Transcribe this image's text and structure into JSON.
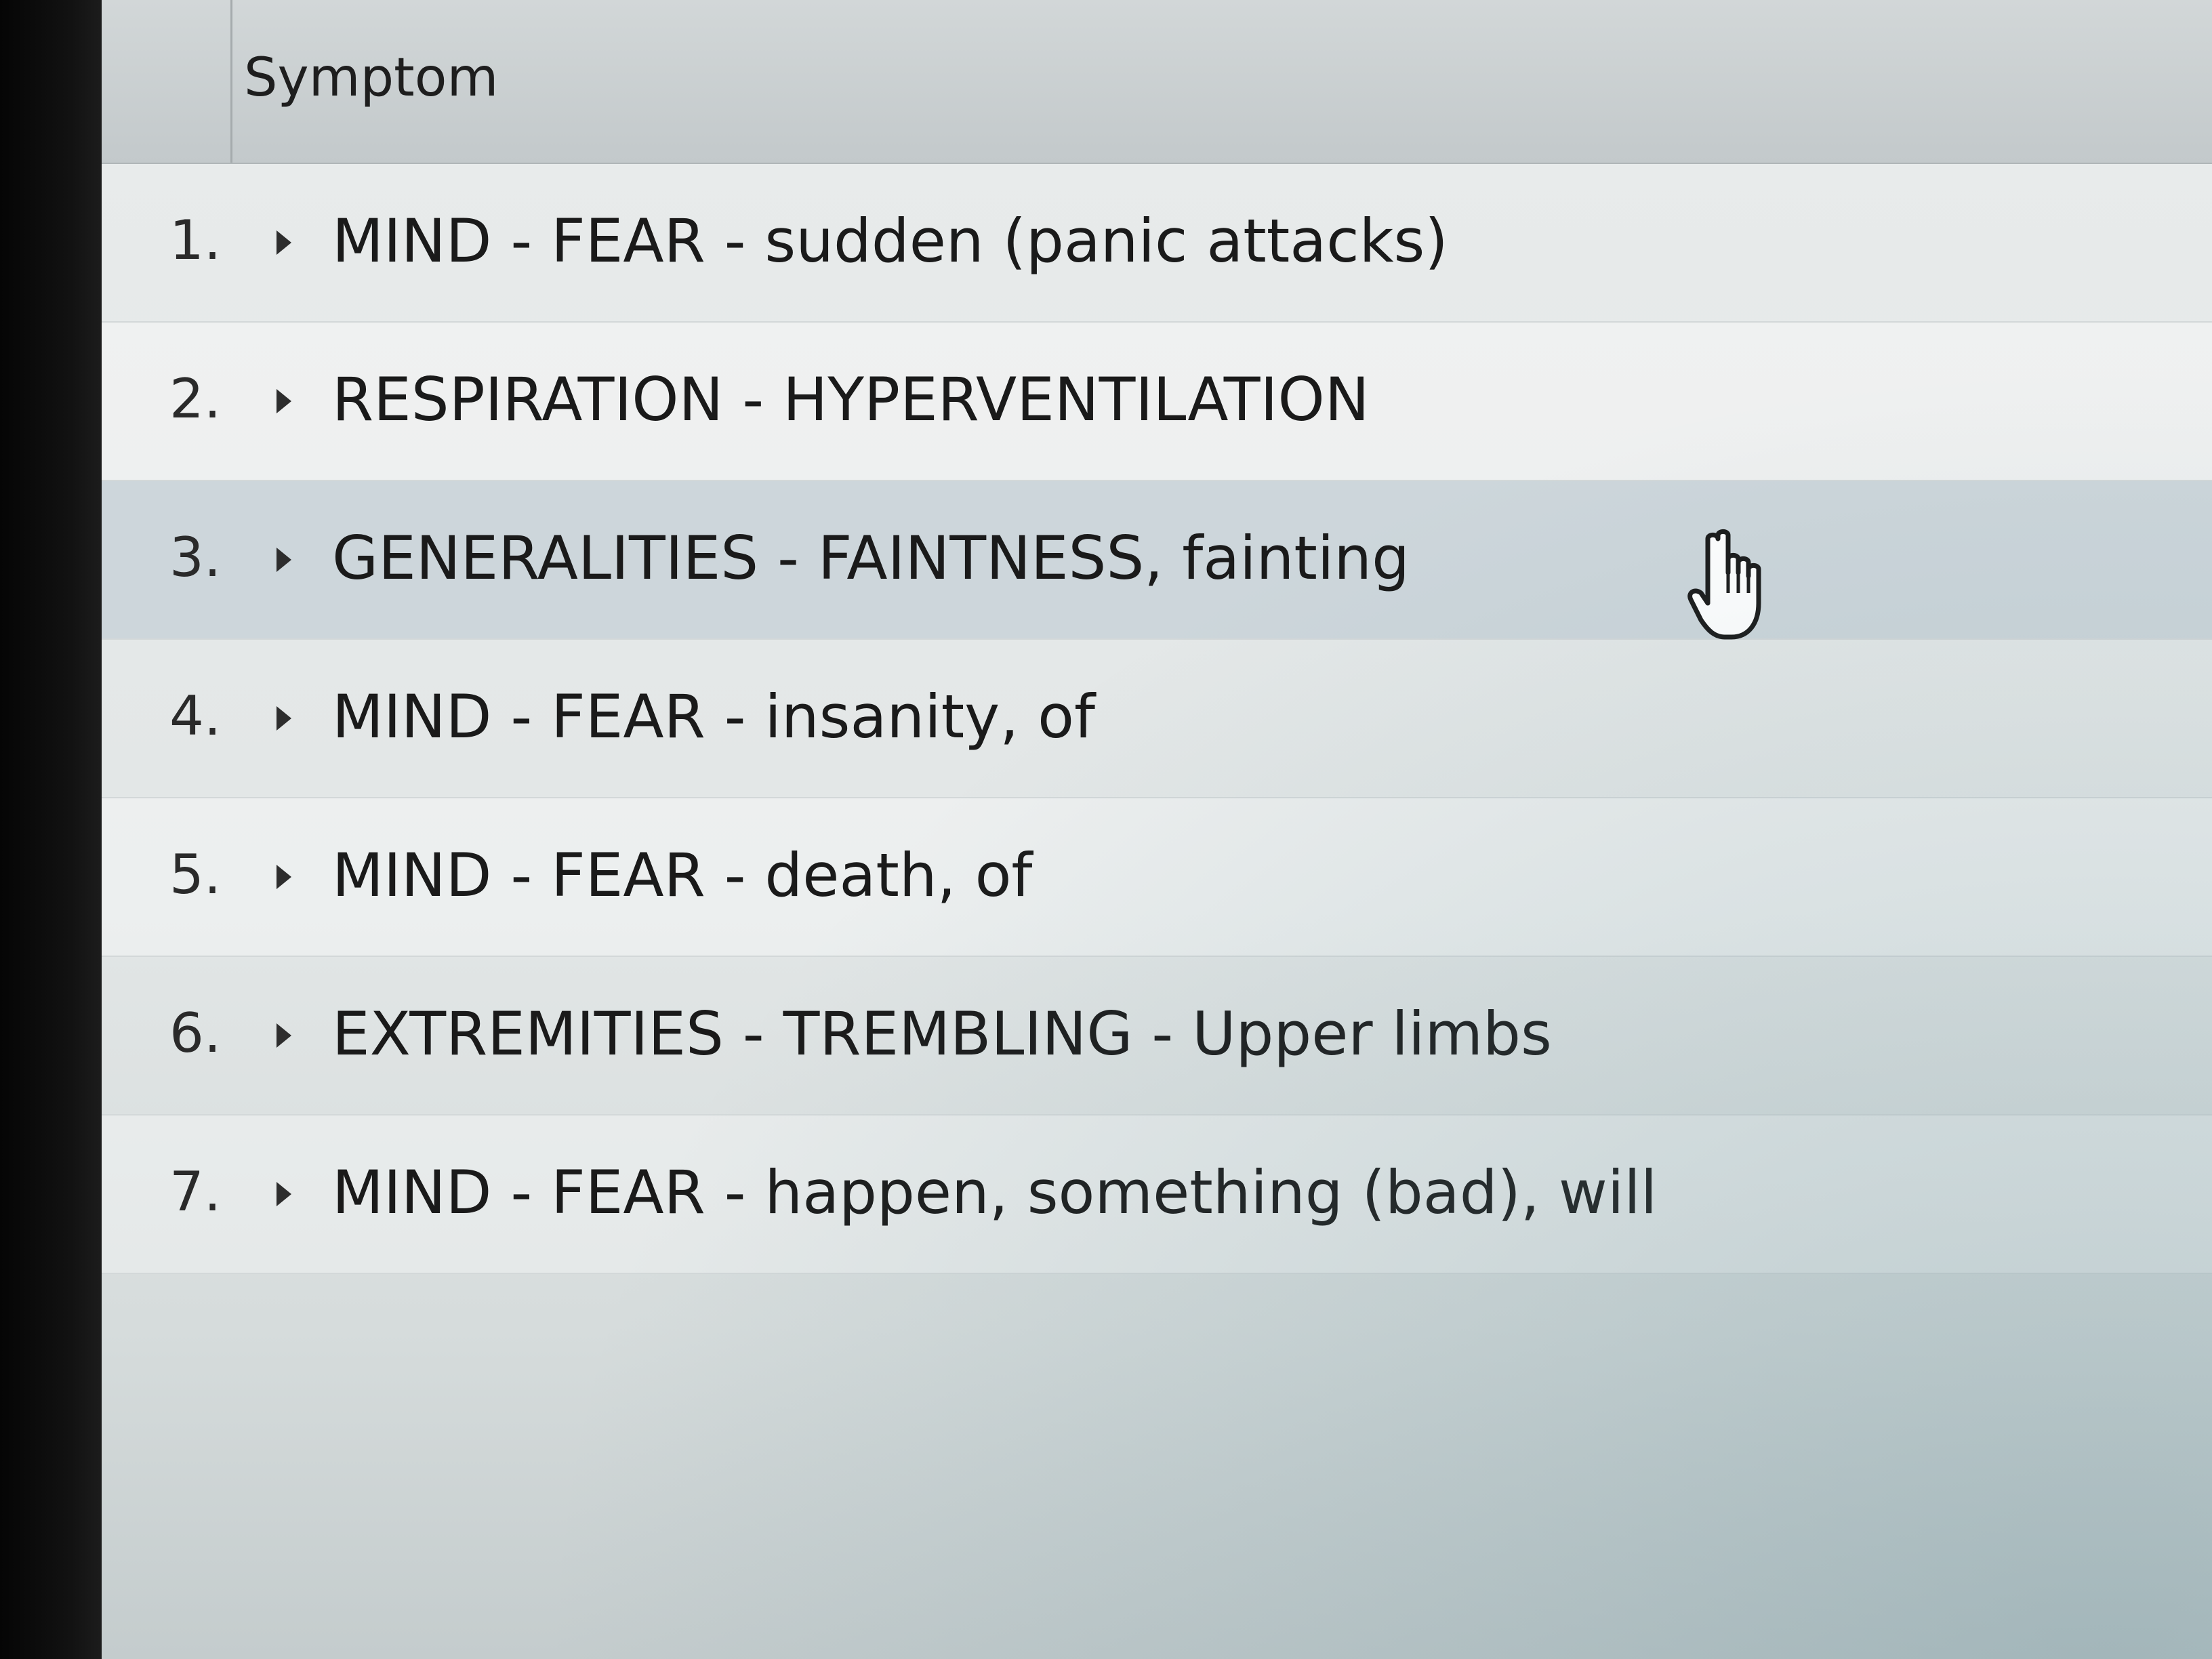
{
  "table": {
    "header": {
      "symptom_column": "Symptom"
    },
    "rows": [
      {
        "num": "1.",
        "symptom": "MIND - FEAR - sudden (panic attacks)"
      },
      {
        "num": "2.",
        "symptom": "RESPIRATION - HYPERVENTILATION"
      },
      {
        "num": "3.",
        "symptom": "GENERALITIES - FAINTNESS, fainting"
      },
      {
        "num": "4.",
        "symptom": "MIND - FEAR - insanity, of"
      },
      {
        "num": "5.",
        "symptom": "MIND - FEAR - death, of"
      },
      {
        "num": "6.",
        "symptom": "EXTREMITIES - TREMBLING - Upper limbs"
      },
      {
        "num": "7.",
        "symptom": "MIND - FEAR - happen, something (bad), will"
      }
    ],
    "selected_row": 3
  },
  "icons": {
    "expand": "expand-triangle-icon",
    "cursor": "hand-pointer-icon"
  },
  "colors": {
    "selected_row_bg": "#cdd6db",
    "header_bg": "#c9cfd1",
    "text": "#1a1a1a"
  }
}
